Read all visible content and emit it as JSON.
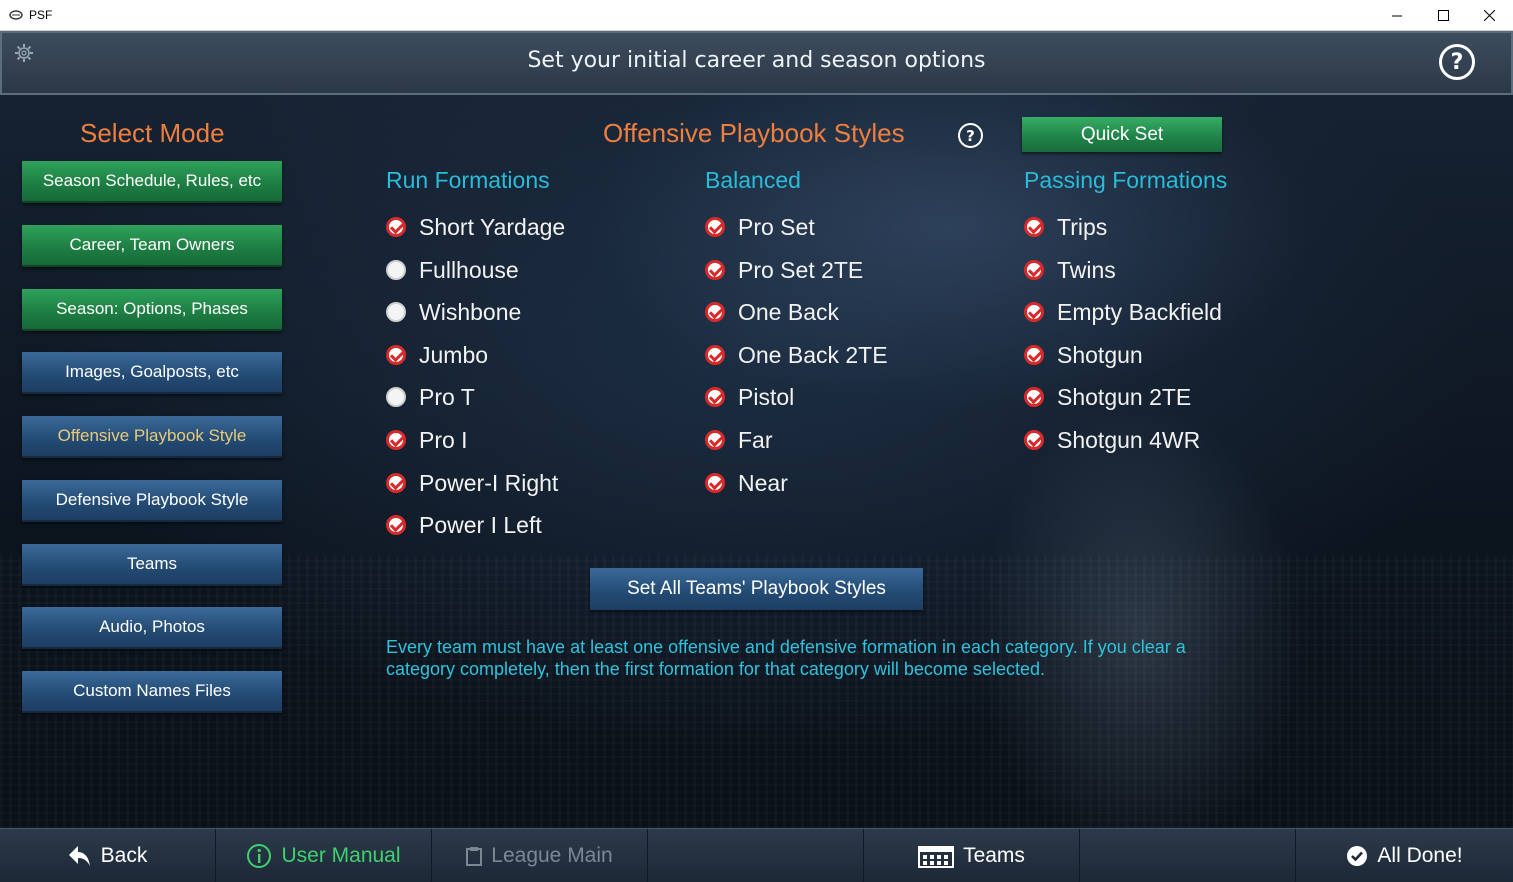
{
  "window": {
    "app_name": "PSF"
  },
  "header": {
    "title": "Set your initial career and season options",
    "help_label": "?"
  },
  "nav": {
    "title": "Select Mode",
    "items": [
      {
        "label": "Season Schedule, Rules, etc",
        "style": "green"
      },
      {
        "label": "Career, Team Owners",
        "style": "green"
      },
      {
        "label": "Season: Options, Phases",
        "style": "green"
      },
      {
        "label": "Images, Goalposts, etc",
        "style": "blue"
      },
      {
        "label": "Offensive Playbook Style",
        "style": "active"
      },
      {
        "label": "Defensive Playbook Style",
        "style": "blue"
      },
      {
        "label": "Teams",
        "style": "blue"
      },
      {
        "label": "Audio, Photos",
        "style": "blue"
      },
      {
        "label": "Custom Names Files",
        "style": "blue"
      }
    ]
  },
  "content": {
    "title": "Offensive Playbook Styles",
    "help_label": "?",
    "quick_set_label": "Quick Set",
    "columns": [
      {
        "title": "Run Formations",
        "options": [
          {
            "label": "Short Yardage",
            "checked": true
          },
          {
            "label": "Fullhouse",
            "checked": false
          },
          {
            "label": "Wishbone",
            "checked": false
          },
          {
            "label": "Jumbo",
            "checked": true
          },
          {
            "label": "Pro T",
            "checked": false
          },
          {
            "label": "Pro I",
            "checked": true
          },
          {
            "label": "Power-I Right",
            "checked": true
          },
          {
            "label": "Power I Left",
            "checked": true
          }
        ]
      },
      {
        "title": "Balanced",
        "options": [
          {
            "label": "Pro Set",
            "checked": true
          },
          {
            "label": "Pro Set 2TE",
            "checked": true
          },
          {
            "label": "One Back",
            "checked": true
          },
          {
            "label": "One Back 2TE",
            "checked": true
          },
          {
            "label": "Pistol",
            "checked": true
          },
          {
            "label": "Far",
            "checked": true
          },
          {
            "label": "Near",
            "checked": true
          }
        ]
      },
      {
        "title": "Passing Formations",
        "options": [
          {
            "label": "Trips",
            "checked": true
          },
          {
            "label": "Twins",
            "checked": true
          },
          {
            "label": "Empty Backfield",
            "checked": true
          },
          {
            "label": "Shotgun",
            "checked": true
          },
          {
            "label": "Shotgun 2TE",
            "checked": true
          },
          {
            "label": "Shotgun 4WR",
            "checked": true
          }
        ]
      }
    ],
    "set_all_label": "Set All Teams' Playbook Styles",
    "info_text": "Every team must have at least one offensive and defensive formation in each category.  If you clear a category completely, then the first formation for that category will become selected."
  },
  "footer": {
    "back": "Back",
    "user_manual": "User Manual",
    "league_main": "League Main",
    "teams": "Teams",
    "all_done": "All Done!"
  },
  "colors": {
    "accent_orange": "#ee7f3e",
    "accent_cyan": "#29bcd8",
    "check_red": "#d82a2a",
    "nav_green": "#1e7f44",
    "nav_blue": "#244c76",
    "active_text": "#e8cb7a"
  }
}
